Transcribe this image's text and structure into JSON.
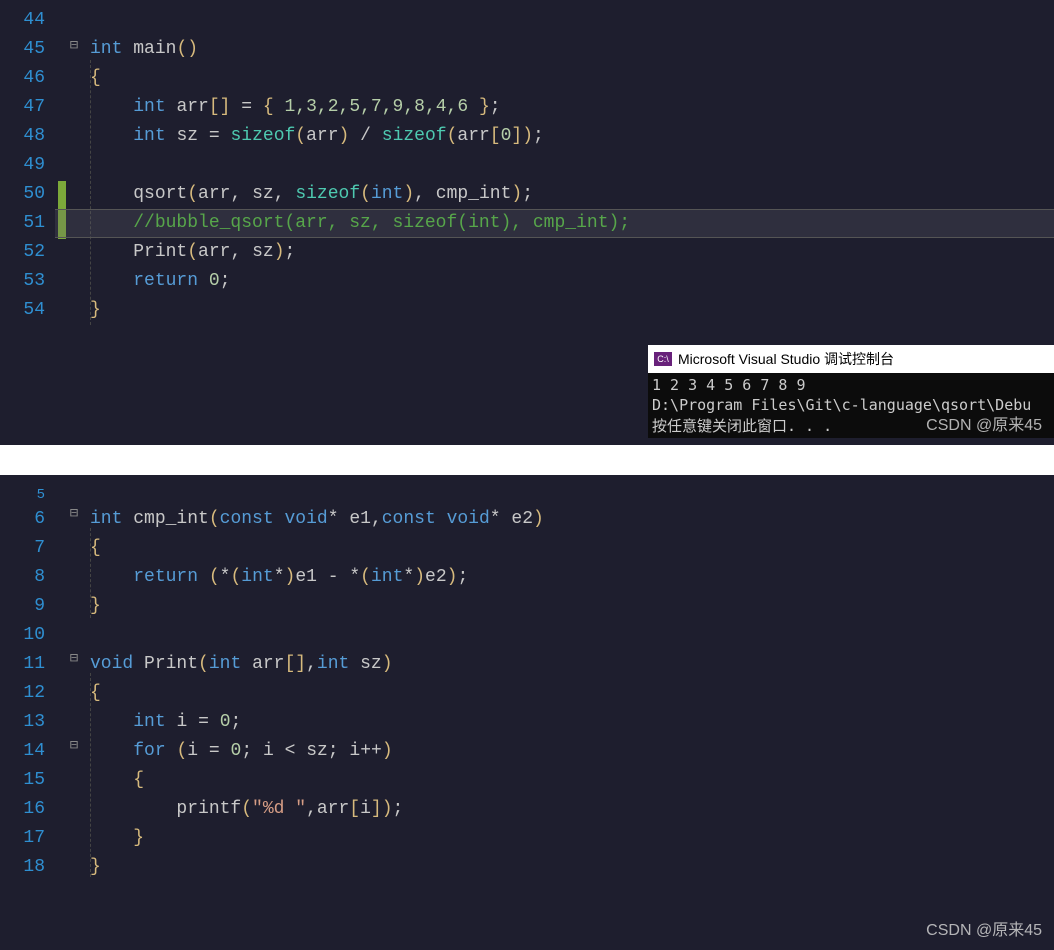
{
  "block1": {
    "line_numbers": [
      "44",
      "45",
      "46",
      "47",
      "48",
      "49",
      "50",
      "51",
      "52",
      "53",
      "54"
    ],
    "lines": {
      "l45_kw": "int",
      "l45_main": "main",
      "l47_kw": "int",
      "l47_arr": "arr",
      "l47_nums": "1,3,2,5,7,9,8,4,6",
      "l48_kw": "int",
      "l48_sz": "sz",
      "l48_sizeof1": "sizeof",
      "l48_arr": "arr",
      "l48_sizeof2": "sizeof",
      "l48_arr2": "arr",
      "l48_idx": "0",
      "l50_fn": "qsort",
      "l50_a1": "arr",
      "l50_a2": "sz",
      "l50_sizeof": "sizeof",
      "l50_int": "int",
      "l50_cmp": "cmp_int",
      "l51_comment": "//bubble_qsort(arr, sz, sizeof(int), cmp_int);",
      "l52_fn": "Print",
      "l52_a1": "arr",
      "l52_a2": "sz",
      "l53_kw": "return",
      "l53_val": "0"
    }
  },
  "block2": {
    "line_numbers": [
      "5",
      "6",
      "7",
      "8",
      "9",
      "10",
      "11",
      "12",
      "13",
      "14",
      "15",
      "16",
      "17",
      "18"
    ],
    "lines": {
      "l6_kw": "int",
      "l6_fn": "cmp_int",
      "l6_const1": "const",
      "l6_void1": "void",
      "l6_e1": "e1",
      "l6_const2": "const",
      "l6_void2": "void",
      "l6_e2": "e2",
      "l8_kw": "return",
      "l8_int1": "int",
      "l8_e1": "e1",
      "l8_int2": "int",
      "l8_e2": "e2",
      "l11_void": "void",
      "l11_fn": "Print",
      "l11_int": "int",
      "l11_arr": "arr",
      "l11_int2": "int",
      "l11_sz": "sz",
      "l13_kw": "int",
      "l13_i": "i",
      "l13_val": "0",
      "l14_for": "for",
      "l14_i": "i",
      "l14_z": "0",
      "l14_i2": "i",
      "l14_sz": "sz",
      "l14_i3": "i",
      "l16_fn": "printf",
      "l16_str": "\"%d \"",
      "l16_arr": "arr",
      "l16_i": "i"
    }
  },
  "console": {
    "icon_text": "C:\\",
    "title": "Microsoft Visual Studio 调试控制台",
    "out1": "1 2 3 4 5 6 7 8 9",
    "out2": "D:\\Program Files\\Git\\c-language\\qsort\\Debu",
    "out3": "按任意键关闭此窗口. . ."
  },
  "watermark": "CSDN @原来45"
}
